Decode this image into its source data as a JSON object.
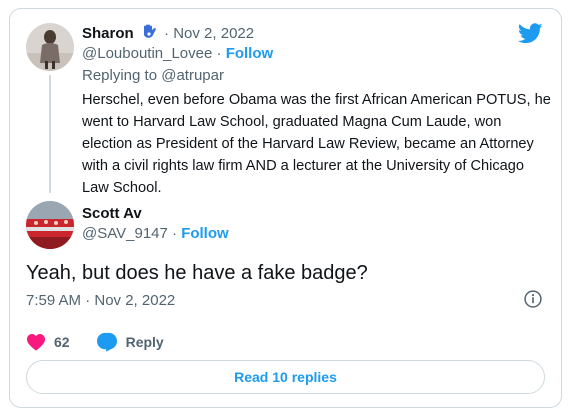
{
  "colors": {
    "accent": "#1d9bf0",
    "muted": "#536471",
    "text": "#0f1419",
    "border": "#cfd9de",
    "heart": "#f91880"
  },
  "icons": {
    "brand": "twitter-bird-icon",
    "verified_emoji": "hamsa-hand-icon",
    "info": "info-icon",
    "like": "heart-icon",
    "reply": "reply-bubble-icon"
  },
  "parent_tweet": {
    "author_name": "Sharon",
    "separator": "·",
    "date": "Nov 2, 2022",
    "handle": "@Louboutin_Lovee",
    "follow_label": "Follow",
    "replying_prefix": "Replying to",
    "replying_handle": "@atrupar",
    "text": "Herschel, even before Obama was the first African American POTUS, he went to Harvard Law School, graduated Magna Cum Laude, won election as President of the Harvard Law Review, became an Attorney with a civil rights law firm AND a lecturer at the University of Chicago Law School."
  },
  "main_tweet": {
    "author_name": "Scott Av",
    "handle": "@SAV_9147",
    "separator": "·",
    "follow_label": "Follow",
    "text": "Yeah, but does he have a fake badge?",
    "timestamp": "7:59 AM · Nov 2, 2022",
    "like_count": "62",
    "reply_label": "Reply",
    "read_replies_label": "Read 10 replies"
  }
}
